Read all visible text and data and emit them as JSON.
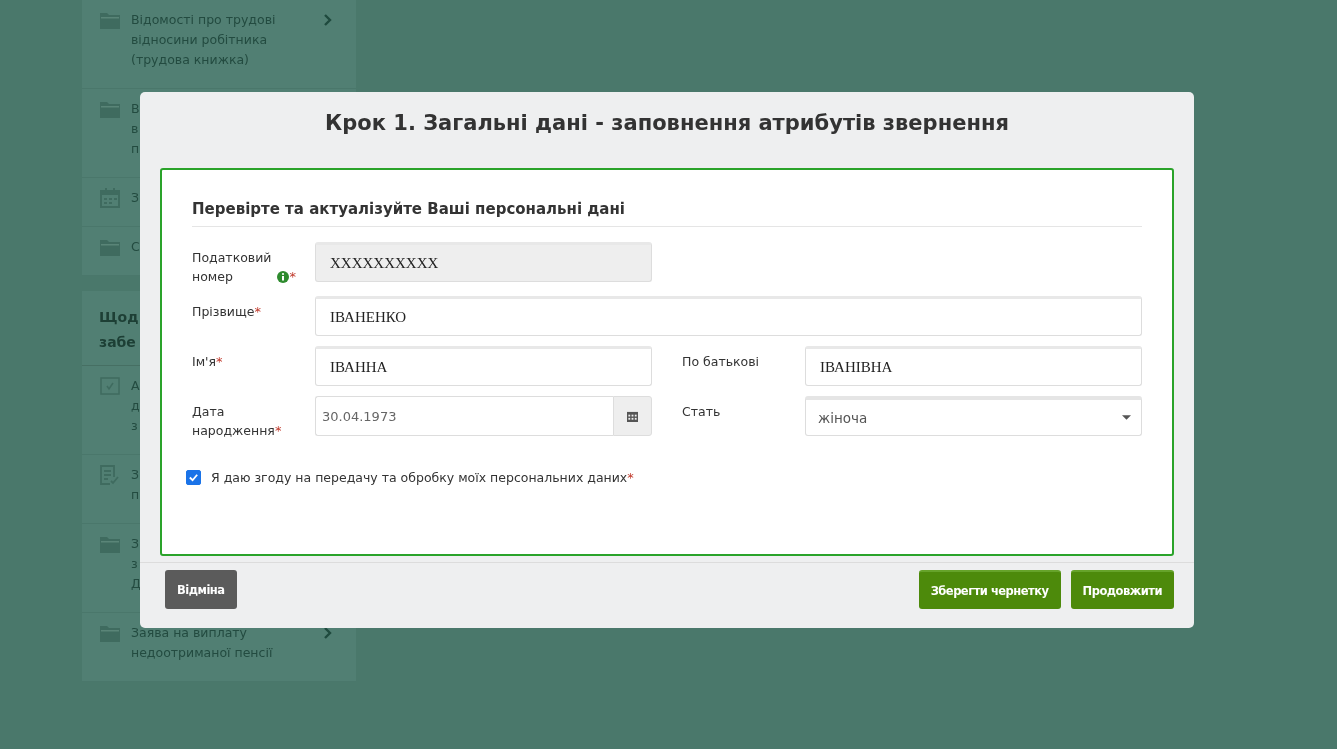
{
  "sidebar": {
    "groups": [
      {
        "items": [
          {
            "kind": "folder",
            "lines": [
              "Відомості про трудові",
              "відносини робітника",
              "(трудова книжка)"
            ],
            "chevron": true
          },
          {
            "kind": "folder",
            "lines": [
              "В",
              "в",
              "п"
            ],
            "chevron": false
          },
          {
            "kind": "calendar",
            "lines": [
              "З"
            ],
            "chevron": false
          },
          {
            "kind": "folder",
            "lines": [
              "С"
            ],
            "chevron": false
          }
        ]
      },
      {
        "heading": [
          "Щод",
          "забе"
        ],
        "items": [
          {
            "kind": "checkbox",
            "lines": [
              "А",
              "д",
              "з"
            ],
            "chevron": false
          },
          {
            "kind": "checklist",
            "lines": [
              "З",
              "п"
            ],
            "chevron": false
          },
          {
            "kind": "folder",
            "lines": [
              "З",
              "з",
              "Д"
            ],
            "chevron": false
          },
          {
            "kind": "folder",
            "lines": [
              "Заява на виплату",
              "недоотриманої пенсії"
            ],
            "chevron": true
          }
        ]
      }
    ]
  },
  "modal": {
    "title": "Крок 1. Загальні дані - заповнення атрибутів звернення",
    "section_title": "Перевірте та актуалізуйте Ваші персональні дані",
    "rows": [
      [
        {
          "kind": "text",
          "label": "Податковий номер",
          "info": true,
          "mark": "*",
          "value": "XXXXXXXXXX",
          "disabled": true
        }
      ],
      [
        {
          "kind": "text",
          "label": "Прізвище",
          "mark": "*",
          "value": "ІВАНЕНКО",
          "disabled": false
        }
      ],
      [
        {
          "kind": "text",
          "label": "Ім'я",
          "mark": "*",
          "value": "ІВАННА",
          "disabled": false
        },
        {
          "kind": "text",
          "label": "По батькові",
          "value": "ІВАНІВНА",
          "disabled": false
        }
      ],
      [
        {
          "kind": "date",
          "label": "Дата народження",
          "mark": "*",
          "value": "30.04.1973",
          "disabled": false
        },
        {
          "kind": "select",
          "label": "Стать",
          "value": "жіноча",
          "disabled": false
        }
      ]
    ],
    "consent": {
      "checked": true,
      "label": "Я даю згоду на передачу та обробку моїх персональних даних",
      "mark": "*"
    },
    "buttons": [
      {
        "label": "Відміна",
        "kind": "cancel"
      },
      {
        "label": "Зберегти чернетку",
        "kind": "primary"
      },
      {
        "label": "Продовжити",
        "kind": "primary"
      }
    ]
  }
}
